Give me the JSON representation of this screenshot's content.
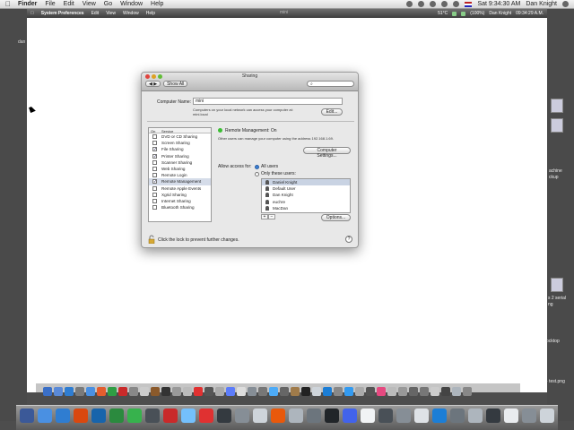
{
  "menubar": {
    "app": "Finder",
    "items": [
      "File",
      "Edit",
      "View",
      "Go",
      "Window",
      "Help"
    ],
    "clock": "Sat 9:34:30 AM",
    "user": "Dan Knight"
  },
  "remote": {
    "menubar": {
      "app": "System Preferences",
      "items": [
        "Edit",
        "View",
        "Window",
        "Help"
      ],
      "window_title": "mini",
      "temp": "51°C",
      "battery": "(100%)",
      "user": "Dan Knight",
      "clock": "09:34:29 A.M."
    }
  },
  "window": {
    "title": "Sharing",
    "show_all": "Show All",
    "search_placeholder": "",
    "computer_name_label": "Computer Name:",
    "computer_name_value": "mini",
    "computer_name_desc": "Computers on your local network can access your computer at: mini.local",
    "edit_button": "Edit...",
    "services_header_on": "On",
    "services_header_service": "Service",
    "services": [
      {
        "label": "DVD or CD Sharing",
        "on": false
      },
      {
        "label": "Screen Sharing",
        "on": false
      },
      {
        "label": "File Sharing",
        "on": true
      },
      {
        "label": "Printer Sharing",
        "on": true
      },
      {
        "label": "Scanner Sharing",
        "on": false
      },
      {
        "label": "Web Sharing",
        "on": false
      },
      {
        "label": "Remote Login",
        "on": false
      },
      {
        "label": "Remote Management",
        "on": true,
        "selected": true
      },
      {
        "label": "Remote Apple Events",
        "on": false
      },
      {
        "label": "Xgrid Sharing",
        "on": false
      },
      {
        "label": "Internet Sharing",
        "on": false
      },
      {
        "label": "Bluetooth Sharing",
        "on": false
      }
    ],
    "status": "Remote Management: On",
    "status_desc": "Other users can manage your computer using the address 192.168.1.69.",
    "computer_settings_button": "Computer Settings...",
    "allow_access_label": "Allow access for:",
    "all_users": "All users",
    "only_these_users": "Only these users:",
    "users": [
      "Daniel Knight",
      "Default User",
      "Dan Knight",
      "euchre",
      "MacDan"
    ],
    "plus": "+",
    "minus": "−",
    "options_button": "Options...",
    "lock_text": "Click the lock to prevent further changes.",
    "help": "?"
  },
  "desktop": {
    "left_label": "dan",
    "right_labels": [
      "achine",
      "ckup",
      "s 2 serial",
      "ng",
      "ocktop",
      "- test.png"
    ]
  },
  "colors": {
    "status_green": "#3bbd33",
    "selection": "#d5dce9",
    "radio_selected": "#3a7fd6"
  }
}
